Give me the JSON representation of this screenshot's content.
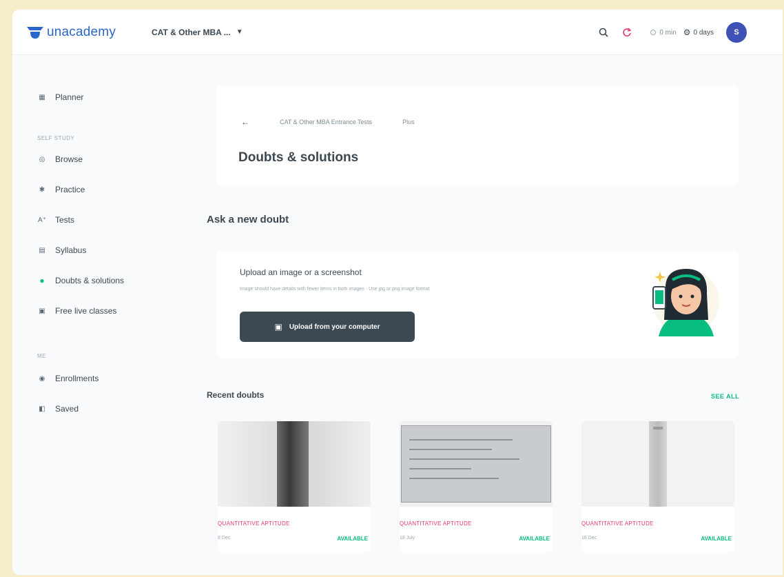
{
  "brand": {
    "name": "unacademy",
    "color": "#2a66c9"
  },
  "header": {
    "goal": "CAT & Other MBA ...",
    "streak1": "0 min",
    "streak2": "0 days",
    "avatar_initial": "S"
  },
  "sidebar": {
    "items_top": [
      {
        "label": "Planner",
        "icon": "planner-icon"
      }
    ],
    "self_study_label": "SELF STUDY",
    "items_study": [
      {
        "label": "Browse",
        "icon": "browse-icon"
      },
      {
        "label": "Practice",
        "icon": "practice-icon"
      },
      {
        "label": "Tests",
        "icon": "tests-icon"
      },
      {
        "label": "Syllabus",
        "icon": "syllabus-icon"
      },
      {
        "label": "Doubts & solutions",
        "icon": "doubts-icon",
        "active": true
      },
      {
        "label": "Free live classes",
        "icon": "live-classes-icon"
      }
    ],
    "me_label": "ME",
    "items_me": [
      {
        "label": "Enrollments",
        "icon": "enrollments-icon"
      },
      {
        "label": "Saved",
        "icon": "saved-icon"
      }
    ]
  },
  "page": {
    "breadcrumb": [
      "CAT & Other MBA Entrance Tests",
      "Plus"
    ],
    "title": "Doubts & solutions"
  },
  "ask": {
    "section_title": "Ask a new doubt",
    "upload_title": "Upload an image or a screenshot",
    "upload_subtitle": "Image should have details with fewer items in both images - Use jpg or png image format",
    "upload_button": "Upload from your computer"
  },
  "recent": {
    "section_title": "Recent doubts",
    "see_all": "SEE ALL",
    "items": [
      {
        "tag": "QUANTITATIVE APTITUDE",
        "meta": "8 Dec",
        "status": "AVAILABLE"
      },
      {
        "tag": "QUANTITATIVE APTITUDE",
        "meta": "18 July",
        "status": "AVAILABLE"
      },
      {
        "tag": "QUANTITATIVE APTITUDE",
        "meta": "18 Dec",
        "status": "AVAILABLE"
      }
    ]
  },
  "colors": {
    "accent": "#08bd80",
    "tag": "#e5366c",
    "button": "#3c4852",
    "avatar": "#3f51b5"
  }
}
